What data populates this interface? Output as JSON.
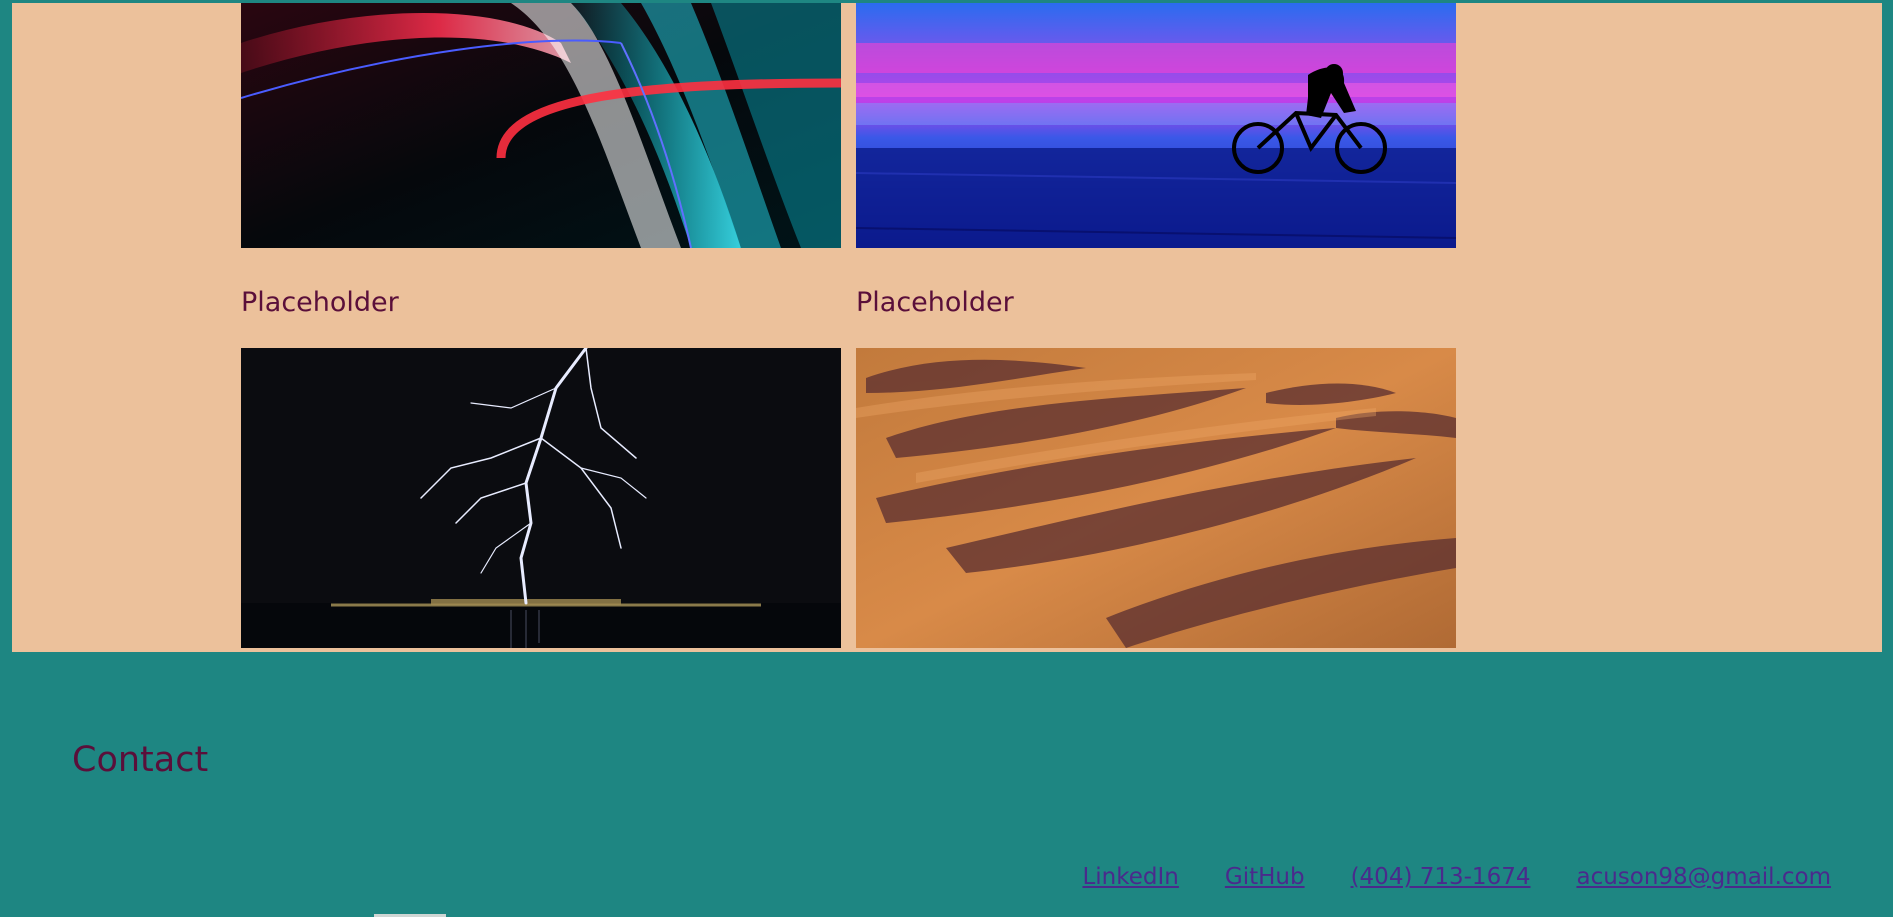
{
  "projects": [
    {
      "title": "",
      "image": "light-trails-photo"
    },
    {
      "title": "",
      "image": "cyclist-neon-photo"
    },
    {
      "title": "Placeholder",
      "image": "lightning-photo"
    },
    {
      "title": "Placeholder",
      "image": "desert-dunes-photo"
    }
  ],
  "contact": {
    "heading": "Contact",
    "links": [
      {
        "label": "LinkedIn"
      },
      {
        "label": "GitHub"
      },
      {
        "label": "(404) 713-1674"
      },
      {
        "label": "acuson98@gmail.com"
      }
    ]
  },
  "colors": {
    "page_background": "#1e8682",
    "panel_background": "#ecc19b",
    "heading_text": "#5a0f3a",
    "link_text": "#4a2a8c"
  }
}
